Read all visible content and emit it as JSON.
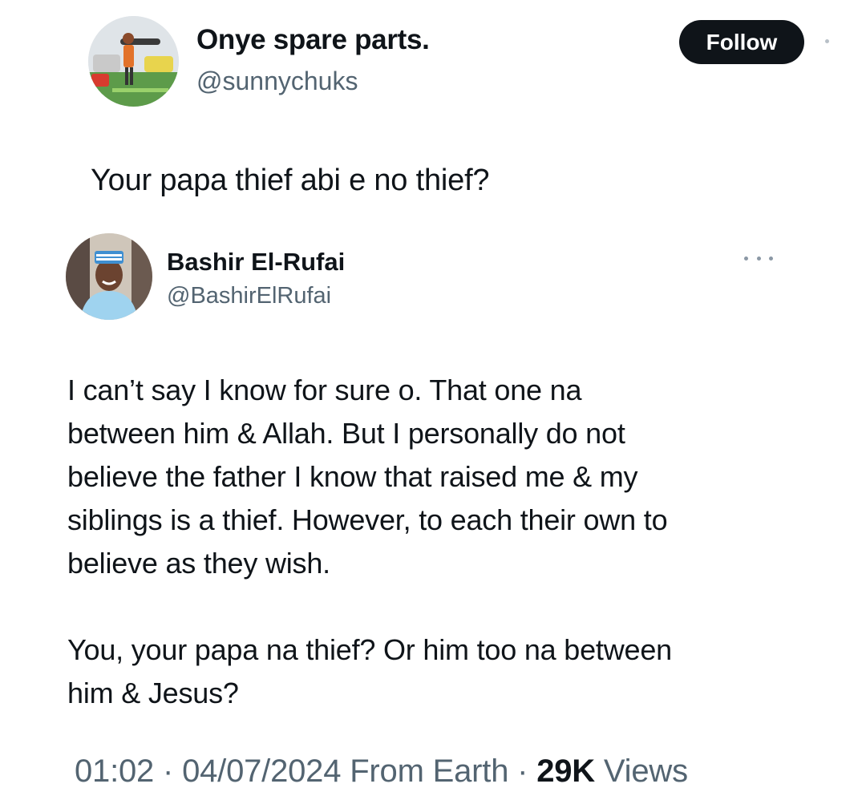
{
  "outer_tweet": {
    "display_name": "Onye spare parts.",
    "handle": "@sunnychuks",
    "follow_label": "Follow",
    "text": "Your papa thief abi e no thief?"
  },
  "reply_tweet": {
    "display_name": "Bashir El-Rufai",
    "handle": "@BashirElRufai",
    "paragraph1_lines": [
      "I can’t say I know for sure o. That one na",
      "between him & Allah. But I personally do not",
      "believe the father I know that raised me & my",
      "siblings is a thief. However, to each their own to",
      "believe as they wish."
    ],
    "paragraph2_lines": [
      "You, your papa na thief? Or him too na between",
      "him & Jesus?"
    ]
  },
  "meta": {
    "time": "01:02",
    "separator": "·",
    "date": "04/07/2024",
    "source": "From Earth",
    "views_count": "29K",
    "views_label": "Views"
  },
  "icons": {
    "more": "more-icon"
  },
  "colors": {
    "text_primary": "#0f1419",
    "text_secondary": "#536471",
    "follow_bg": "#0f1419"
  }
}
